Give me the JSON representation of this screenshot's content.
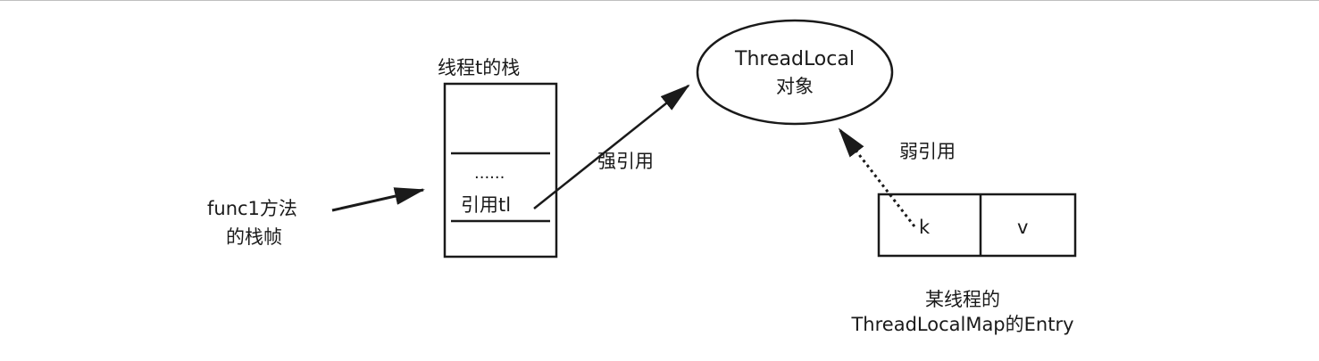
{
  "stack": {
    "title": "线程t的栈",
    "ellipsis": "......",
    "ref_label": "引用tl"
  },
  "frame_label": {
    "line1": "func1方法",
    "line2": "的栈帧"
  },
  "strong_ref": "强引用",
  "threadlocal": {
    "line1": "ThreadLocal",
    "line2": "对象"
  },
  "weak_ref": "弱引用",
  "entry": {
    "key": "k",
    "value": "v",
    "caption_line1": "某线程的",
    "caption_line2": "ThreadLocalMap的Entry"
  }
}
